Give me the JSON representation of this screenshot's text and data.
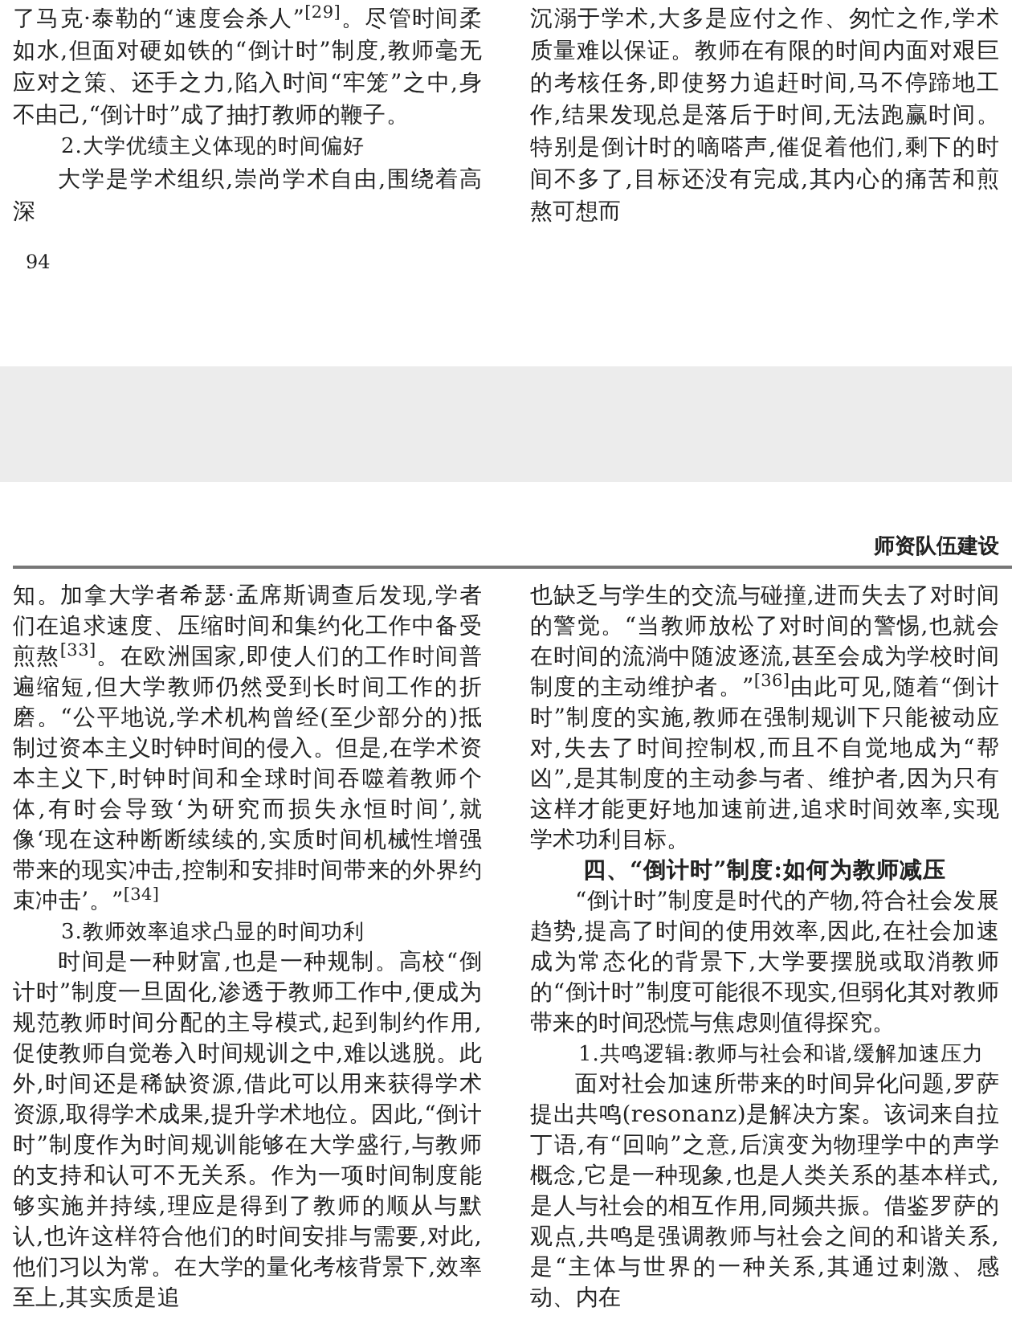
{
  "pages": [
    {
      "columns": [
        [
          {
            "kind": "continuation",
            "text": "了马克·泰勒的“速度会杀人”$^{[29]}$。尽管时间柔如水,但面对硬如铁的“倒计时”制度,教师毫无应对之策、还手之力,陷入时间“牢笼”之中,身不由己,“倒计时”成了抽打教师的鞭子。"
          },
          {
            "kind": "subheading",
            "text": "2.大学优绩主义体现的时间偏好"
          },
          {
            "kind": "paragraph",
            "text": "大学是学术组织,崇尚学术自由,围绕着高深"
          }
        ],
        [
          {
            "kind": "continuation",
            "text": "沉溺于学术,大多是应付之作、匆忙之作,学术质量难以保证。教师在有限的时间内面对艰巨的考核任务,即使努力追赶时间,马不停蹄地工作,结果发现总是落后于时间,无法跑赢时间。特别是倒计时的嘀嗒声,催促着他们,剩下的时间不多了,目标还没有完成,其内心的痛苦和煎熬可想而"
          }
        ]
      ],
      "page_number": "94"
    },
    {
      "running_header": "师资队伍建设",
      "columns": [
        [
          {
            "kind": "continuation",
            "text": "知。加拿大学者希瑟·孟席斯调查后发现,学者们在追求速度、压缩时间和集约化工作中备受煎熬$^{[33]}$。在欧洲国家,即使人们的工作时间普遍缩短,但大学教师仍然受到长时间工作的折磨。“公平地说,学术机构曾经(至少部分的)抵制过资本主义时钟时间的侵入。但是,在学术资本主义下,时钟时间和全球时间吞噬着教师个体,有时会导致‘为研究而损失永恒时间’,就像‘现在这种断断续续的,实质时间机械性增强带来的现实冲击,控制和安排时间带来的外界约束冲击’。”$^{[34]}$"
          },
          {
            "kind": "subheading",
            "text": "3.教师效率追求凸显的时间功利"
          },
          {
            "kind": "paragraph",
            "text": "时间是一种财富,也是一种规制。高校“倒计时”制度一旦固化,渗透于教师工作中,便成为规范教师时间分配的主导模式,起到制约作用,促使教师自觉卷入时间规训之中,难以逃脱。此外,时间还是稀缺资源,借此可以用来获得学术资源,取得学术成果,提升学术地位。因此,“倒计时”制度作为时间规训能够在大学盛行,与教师的支持和认可不无关系。作为一项时间制度能够实施并持续,理应是得到了教师的顺从与默认,也许这样符合他们的时间安排与需要,对此,他们习以为常。在大学的量化考核背景下,效率至上,其实质是追"
          }
        ],
        [
          {
            "kind": "continuation",
            "text": "也缺乏与学生的交流与碰撞,进而失去了对时间的警觉。“当教师放松了对时间的警惕,也就会在时间的流淌中随波逐流,甚至会成为学校时间制度的主动维护者。”$^{[36]}$由此可见,随着“倒计时”制度的实施,教师在强制规训下只能被动应对,失去了时间控制权,而且不自觉地成为“帮凶”,是其制度的主动参与者、维护者,因为只有这样才能更好地加速前进,追求时间效率,实现学术功利目标。"
          },
          {
            "kind": "section_title",
            "text": "四、“倒计时”制度:如何为教师减压"
          },
          {
            "kind": "paragraph",
            "text": "“倒计时”制度是时代的产物,符合社会发展趋势,提高了时间的使用效率,因此,在社会加速成为常态化的背景下,大学要摆脱或取消教师的“倒计时”制度可能很不现实,但弱化其对教师带来的时间恐慌与焦虑则值得探究。"
          },
          {
            "kind": "subheading",
            "text": "1.共鸣逻辑:教师与社会和谐,缓解加速压力"
          },
          {
            "kind": "paragraph",
            "text": "面对社会加速所带来的时间异化问题,罗萨提出共鸣(resonanz)是解决方案。该词来自拉丁语,有“回响”之意,后演变为物理学中的声学概念,它是一种现象,也是人类关系的基本样式,是人与社会的相互作用,同频共振。借鉴罗萨的观点,共鸣是强调教师与社会之间的和谐关系,是“主体与世界的一种关系,其通过刺激、感动、内在"
          }
        ]
      ]
    }
  ]
}
